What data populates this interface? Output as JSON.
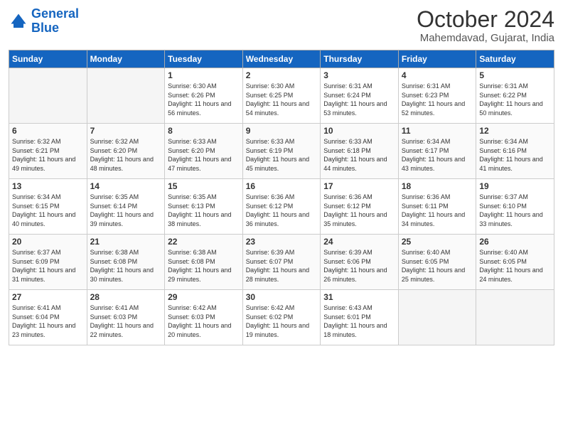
{
  "header": {
    "logo_line1": "General",
    "logo_line2": "Blue",
    "month_title": "October 2024",
    "subtitle": "Mahemdavad, Gujarat, India"
  },
  "days_of_week": [
    "Sunday",
    "Monday",
    "Tuesday",
    "Wednesday",
    "Thursday",
    "Friday",
    "Saturday"
  ],
  "weeks": [
    [
      {
        "num": "",
        "empty": true
      },
      {
        "num": "",
        "empty": true
      },
      {
        "num": "1",
        "sunrise": "6:30 AM",
        "sunset": "6:26 PM",
        "daylight": "11 hours and 56 minutes."
      },
      {
        "num": "2",
        "sunrise": "6:30 AM",
        "sunset": "6:25 PM",
        "daylight": "11 hours and 54 minutes."
      },
      {
        "num": "3",
        "sunrise": "6:31 AM",
        "sunset": "6:24 PM",
        "daylight": "11 hours and 53 minutes."
      },
      {
        "num": "4",
        "sunrise": "6:31 AM",
        "sunset": "6:23 PM",
        "daylight": "11 hours and 52 minutes."
      },
      {
        "num": "5",
        "sunrise": "6:31 AM",
        "sunset": "6:22 PM",
        "daylight": "11 hours and 50 minutes."
      }
    ],
    [
      {
        "num": "6",
        "sunrise": "6:32 AM",
        "sunset": "6:21 PM",
        "daylight": "11 hours and 49 minutes."
      },
      {
        "num": "7",
        "sunrise": "6:32 AM",
        "sunset": "6:20 PM",
        "daylight": "11 hours and 48 minutes."
      },
      {
        "num": "8",
        "sunrise": "6:33 AM",
        "sunset": "6:20 PM",
        "daylight": "11 hours and 47 minutes."
      },
      {
        "num": "9",
        "sunrise": "6:33 AM",
        "sunset": "6:19 PM",
        "daylight": "11 hours and 45 minutes."
      },
      {
        "num": "10",
        "sunrise": "6:33 AM",
        "sunset": "6:18 PM",
        "daylight": "11 hours and 44 minutes."
      },
      {
        "num": "11",
        "sunrise": "6:34 AM",
        "sunset": "6:17 PM",
        "daylight": "11 hours and 43 minutes."
      },
      {
        "num": "12",
        "sunrise": "6:34 AM",
        "sunset": "6:16 PM",
        "daylight": "11 hours and 41 minutes."
      }
    ],
    [
      {
        "num": "13",
        "sunrise": "6:34 AM",
        "sunset": "6:15 PM",
        "daylight": "11 hours and 40 minutes."
      },
      {
        "num": "14",
        "sunrise": "6:35 AM",
        "sunset": "6:14 PM",
        "daylight": "11 hours and 39 minutes."
      },
      {
        "num": "15",
        "sunrise": "6:35 AM",
        "sunset": "6:13 PM",
        "daylight": "11 hours and 38 minutes."
      },
      {
        "num": "16",
        "sunrise": "6:36 AM",
        "sunset": "6:12 PM",
        "daylight": "11 hours and 36 minutes."
      },
      {
        "num": "17",
        "sunrise": "6:36 AM",
        "sunset": "6:12 PM",
        "daylight": "11 hours and 35 minutes."
      },
      {
        "num": "18",
        "sunrise": "6:36 AM",
        "sunset": "6:11 PM",
        "daylight": "11 hours and 34 minutes."
      },
      {
        "num": "19",
        "sunrise": "6:37 AM",
        "sunset": "6:10 PM",
        "daylight": "11 hours and 33 minutes."
      }
    ],
    [
      {
        "num": "20",
        "sunrise": "6:37 AM",
        "sunset": "6:09 PM",
        "daylight": "11 hours and 31 minutes."
      },
      {
        "num": "21",
        "sunrise": "6:38 AM",
        "sunset": "6:08 PM",
        "daylight": "11 hours and 30 minutes."
      },
      {
        "num": "22",
        "sunrise": "6:38 AM",
        "sunset": "6:08 PM",
        "daylight": "11 hours and 29 minutes."
      },
      {
        "num": "23",
        "sunrise": "6:39 AM",
        "sunset": "6:07 PM",
        "daylight": "11 hours and 28 minutes."
      },
      {
        "num": "24",
        "sunrise": "6:39 AM",
        "sunset": "6:06 PM",
        "daylight": "11 hours and 26 minutes."
      },
      {
        "num": "25",
        "sunrise": "6:40 AM",
        "sunset": "6:05 PM",
        "daylight": "11 hours and 25 minutes."
      },
      {
        "num": "26",
        "sunrise": "6:40 AM",
        "sunset": "6:05 PM",
        "daylight": "11 hours and 24 minutes."
      }
    ],
    [
      {
        "num": "27",
        "sunrise": "6:41 AM",
        "sunset": "6:04 PM",
        "daylight": "11 hours and 23 minutes."
      },
      {
        "num": "28",
        "sunrise": "6:41 AM",
        "sunset": "6:03 PM",
        "daylight": "11 hours and 22 minutes."
      },
      {
        "num": "29",
        "sunrise": "6:42 AM",
        "sunset": "6:03 PM",
        "daylight": "11 hours and 20 minutes."
      },
      {
        "num": "30",
        "sunrise": "6:42 AM",
        "sunset": "6:02 PM",
        "daylight": "11 hours and 19 minutes."
      },
      {
        "num": "31",
        "sunrise": "6:43 AM",
        "sunset": "6:01 PM",
        "daylight": "11 hours and 18 minutes."
      },
      {
        "num": "",
        "empty": true
      },
      {
        "num": "",
        "empty": true
      }
    ]
  ],
  "labels": {
    "sunrise": "Sunrise:",
    "sunset": "Sunset:",
    "daylight": "Daylight:"
  }
}
